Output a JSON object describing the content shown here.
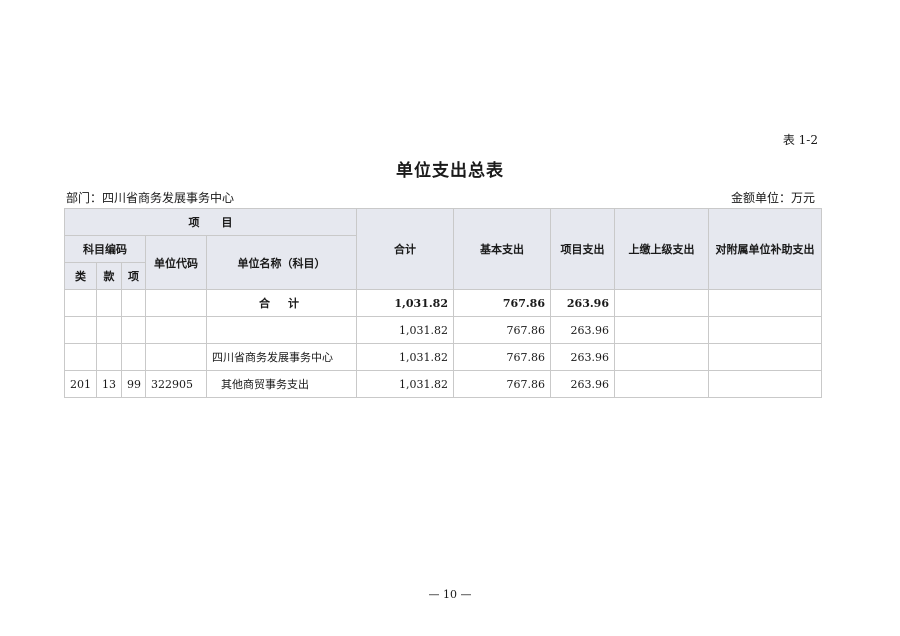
{
  "doc": {
    "table_id": "表 1-2",
    "title": "单位支出总表",
    "department": "部门：四川省商务发展事务中心",
    "unit": "金额单位：万元",
    "page_number": "— 10 —"
  },
  "table": {
    "header_item": "项　　目",
    "header_subject_code": "科目编码",
    "header_class": "类",
    "header_section": "款",
    "header_item_code": "项",
    "header_unit_code": "单位代码",
    "header_unit_name": "单位名称（科目）",
    "header_total": "合计",
    "header_basic": "基本支出",
    "header_project": "项目支出",
    "header_upper": "上缴上级支出",
    "header_subsidy": "对附属单位补助支出",
    "rows": [
      {
        "lei": "",
        "kuan": "",
        "xiang": "",
        "unit_code": "",
        "name": "合计",
        "total": "1,031.82",
        "basic": "767.86",
        "project": "263.96",
        "upper": "",
        "subsidy": ""
      },
      {
        "lei": "",
        "kuan": "",
        "xiang": "",
        "unit_code": "",
        "name": "",
        "total": "1,031.82",
        "basic": "767.86",
        "project": "263.96",
        "upper": "",
        "subsidy": ""
      },
      {
        "lei": "",
        "kuan": "",
        "xiang": "",
        "unit_code": "",
        "name": "四川省商务发展事务中心",
        "total": "1,031.82",
        "basic": "767.86",
        "project": "263.96",
        "upper": "",
        "subsidy": ""
      },
      {
        "lei": "201",
        "kuan": "13",
        "xiang": "99",
        "unit_code": "322905",
        "name": "其他商贸事务支出",
        "total": "1,031.82",
        "basic": "767.86",
        "project": "263.96",
        "upper": "",
        "subsidy": ""
      }
    ]
  }
}
